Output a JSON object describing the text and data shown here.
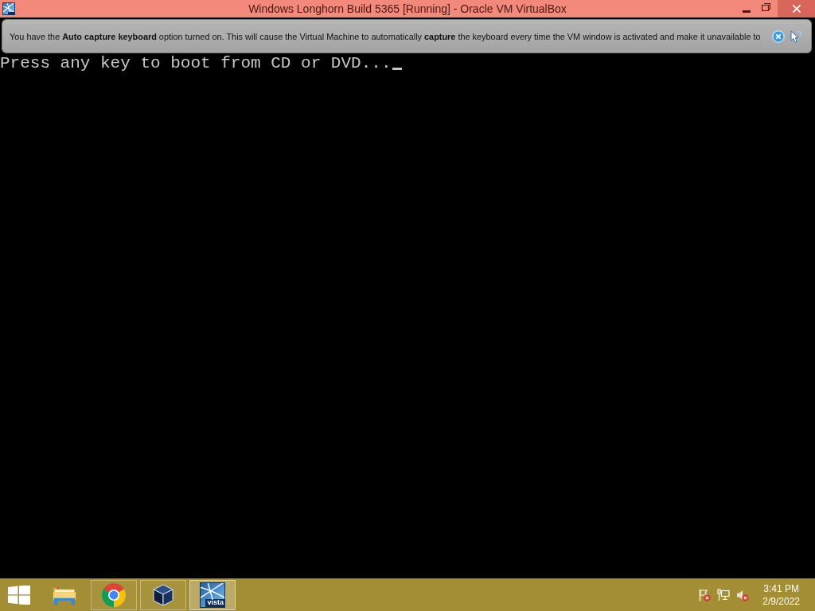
{
  "window": {
    "title": "Windows Longhorn Build 5365 [Running] - Oracle VM VirtualBox"
  },
  "notification": {
    "message": "You have the **Auto capture keyboard** option turned on. This will cause the Virtual Machine to automatically **capture** the keyboard every time the VM window is activated and make it unavailable to"
  },
  "vm_screen": {
    "lines": [
      "Press any key to boot from CD or DVD..."
    ],
    "cursor": true
  },
  "taskbar": {
    "apps": [
      {
        "kind": "folder",
        "running": false,
        "selected": false
      },
      {
        "kind": "browser",
        "running": true,
        "selected": false
      },
      {
        "kind": "cube",
        "running": true,
        "selected": false
      },
      {
        "kind": "logo",
        "label": "vista",
        "running": true,
        "selected": true
      }
    ],
    "tray": [
      {
        "kind": "flag",
        "alert": true
      },
      {
        "kind": "network",
        "alert": false
      },
      {
        "kind": "speaker",
        "alert": true
      }
    ],
    "clock": {
      "time": "3:41 PM",
      "date": "2/9/2022"
    }
  }
}
